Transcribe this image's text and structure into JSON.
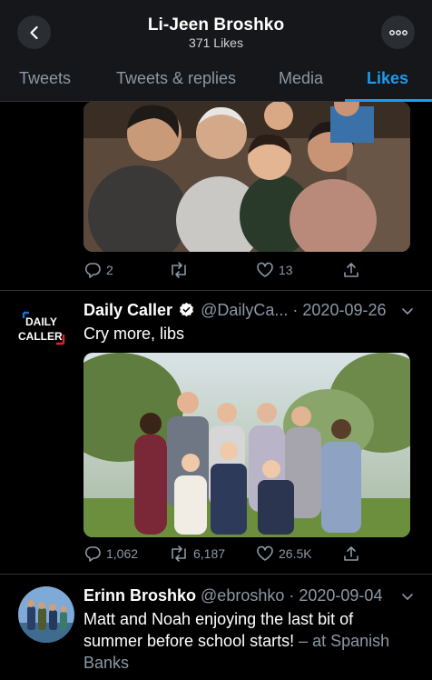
{
  "header": {
    "title": "Li-Jeen Broshko",
    "subtitle": "371 Likes"
  },
  "tabs": [
    {
      "label": "Tweets",
      "active": false
    },
    {
      "label": "Tweets & replies",
      "active": false
    },
    {
      "label": "Media",
      "active": false
    },
    {
      "label": "Likes",
      "active": true
    }
  ],
  "tweets": [
    {
      "image": "family-photo",
      "actions": {
        "replies": "2",
        "retweets": "",
        "likes": "13"
      }
    },
    {
      "name": "Daily Caller",
      "verified": true,
      "handle": "@DailyCa...",
      "date": "2020-09-26",
      "text": "Cry more, libs",
      "avatar_logo": {
        "line1": "DAILY",
        "line2": "CALLER"
      },
      "image": "group-photo-outdoors",
      "actions": {
        "replies": "1,062",
        "retweets": "6,187",
        "likes": "26.5K"
      }
    },
    {
      "name": "Erinn Broshko",
      "handle": "@ebroshko",
      "date": "2020-09-04",
      "text": "Matt and Noah enjoying the last bit of summer before school starts!",
      "location": "– at Spanish Banks"
    }
  ],
  "colors": {
    "accent": "#1d9bf0",
    "muted": "#8b98a5",
    "header_bg": "#15171a",
    "logo_red": "#e0232b"
  },
  "icons": [
    "back-arrow-icon",
    "more-icon",
    "reply-icon",
    "retweet-icon",
    "like-icon",
    "share-icon",
    "verified-icon",
    "chevron-down-icon"
  ]
}
